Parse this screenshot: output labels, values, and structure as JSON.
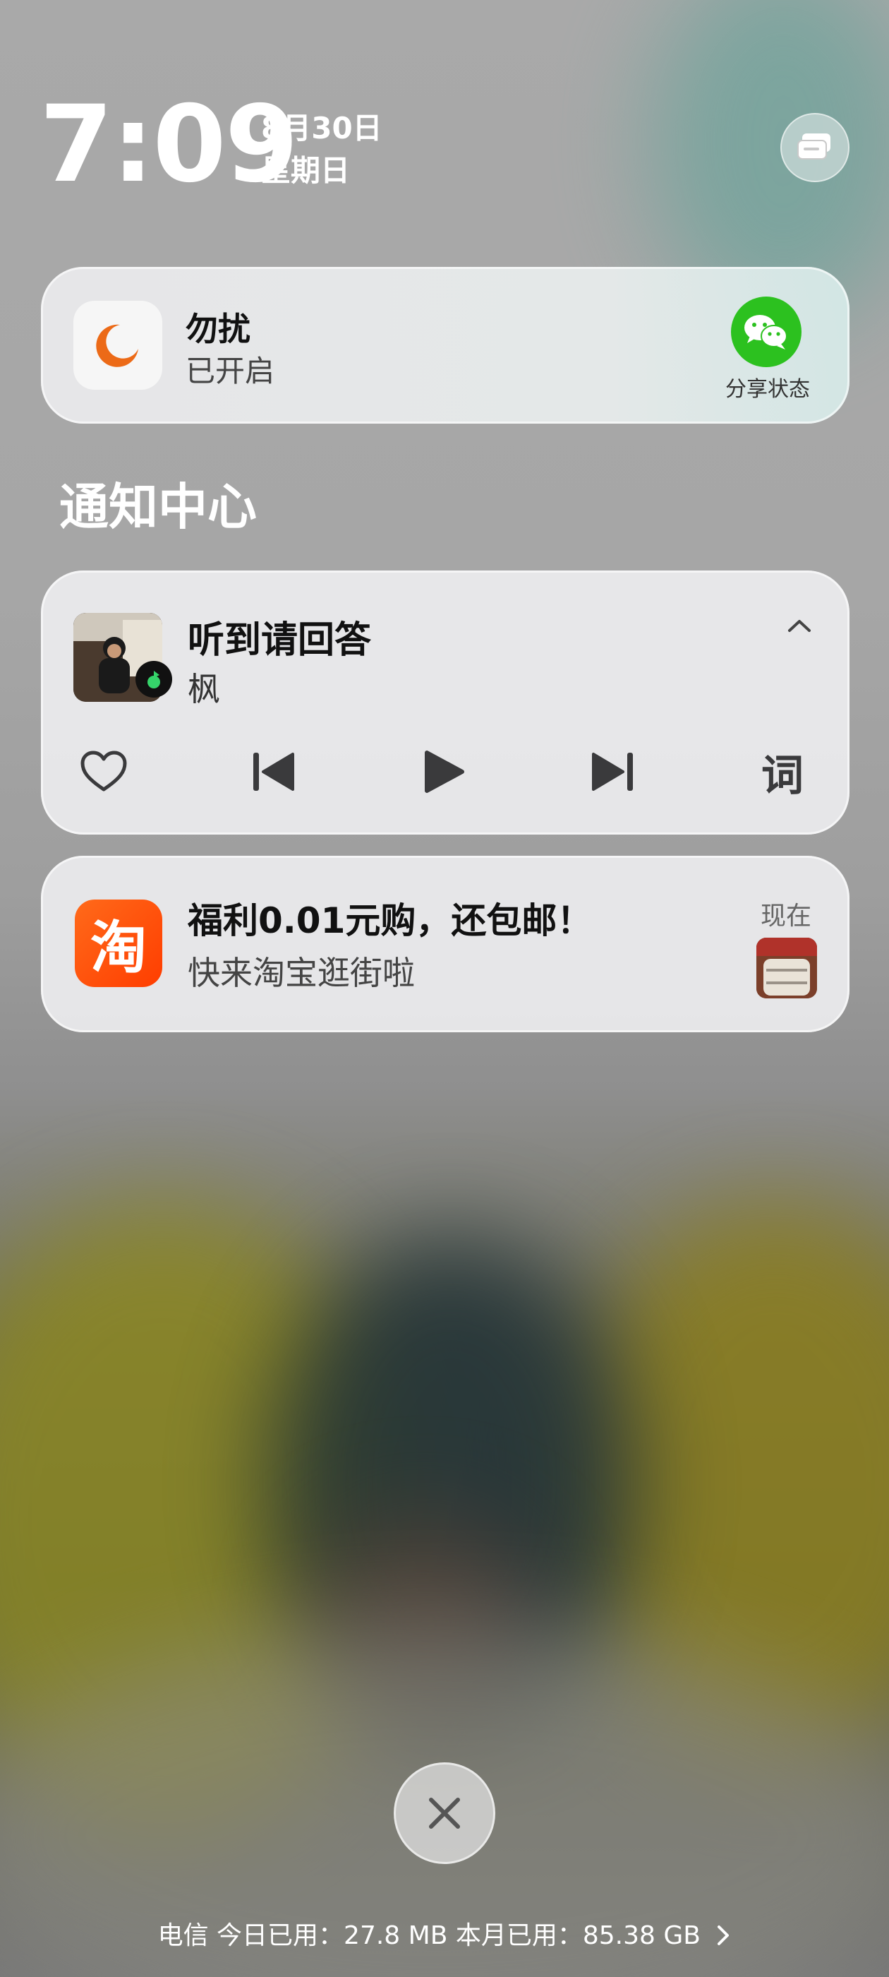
{
  "clock": {
    "time": "7:09",
    "date": "8月30日",
    "weekday": "星期日"
  },
  "dnd": {
    "title": "勿扰",
    "status": "已开启",
    "share_label": "分享状态"
  },
  "section_title": "通知中心",
  "music": {
    "title": "听到请回答",
    "artist": "枫",
    "lyrics_label": "词"
  },
  "taobao": {
    "icon_char": "淘",
    "title": "福利0.01元购，还包邮！",
    "subtitle": "快来淘宝逛街啦",
    "time": "现在"
  },
  "footer": {
    "text": "电信 今日已用：27.8 MB  本月已用：85.38 GB"
  },
  "colors": {
    "wechat": "#2cc11f",
    "taobao": "#ff5000",
    "dnd_moon": "#ec6a17"
  }
}
